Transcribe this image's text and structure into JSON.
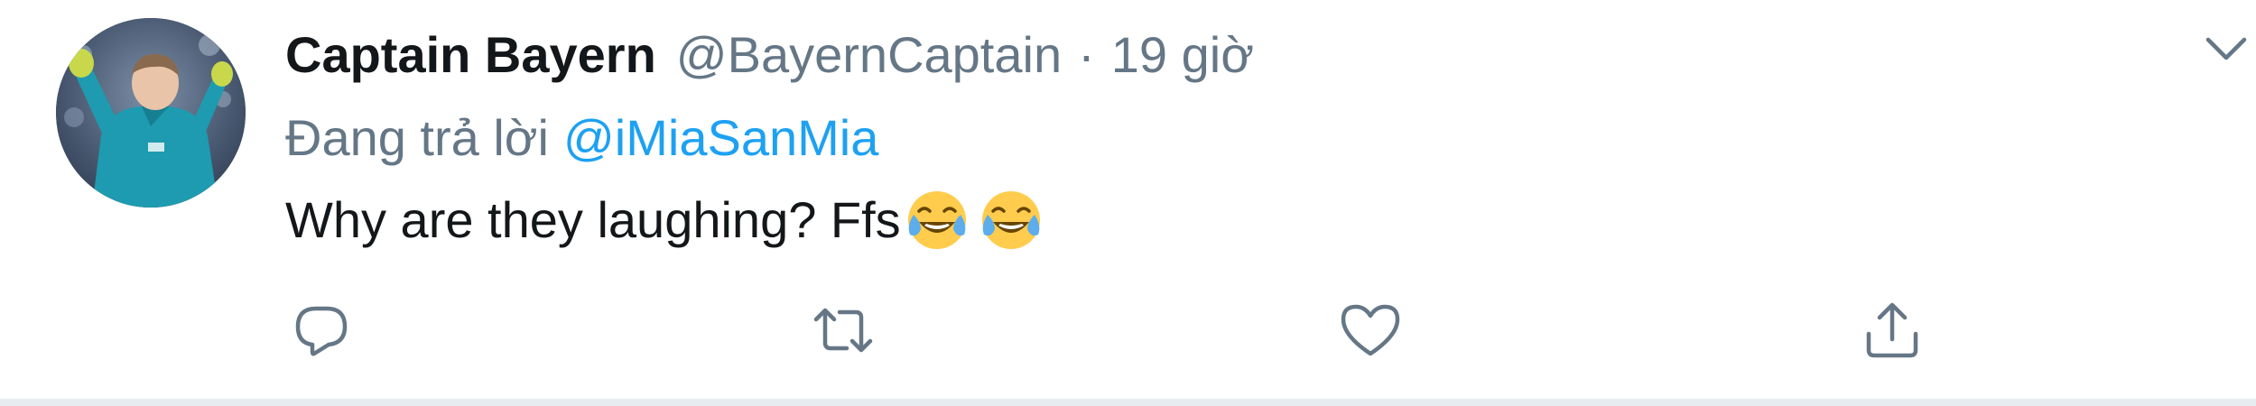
{
  "tweet": {
    "avatar_icon": "user-avatar-photo",
    "display_name": "Captain Bayern",
    "handle": "@BayernCaptain",
    "separator": "·",
    "time": "19 giờ",
    "reply_prefix": "Đang trả lời",
    "reply_to": "@iMiaSanMia",
    "text": "Why are they laughing? Ffs",
    "emojis": [
      "face-with-tears-of-joy",
      "face-with-tears-of-joy"
    ]
  },
  "menu": {
    "icon": "chevron-down-icon"
  },
  "actions": {
    "reply_icon": "reply-icon",
    "retweet_icon": "retweet-icon",
    "like_icon": "heart-icon",
    "share_icon": "share-icon"
  },
  "colors": {
    "text": "#14171a",
    "secondary": "#657786",
    "link": "#1da1f2",
    "border": "#e6ecf0"
  }
}
